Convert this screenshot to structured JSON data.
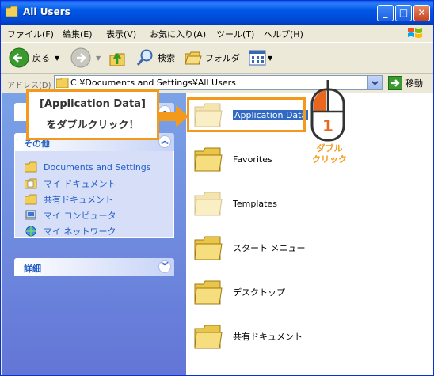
{
  "window": {
    "title": "All Users",
    "buttons": {
      "minimize": "_",
      "maximize": "□",
      "close": "✕"
    }
  },
  "menu": [
    "ファイル(F)",
    "編集(E)",
    "表示(V)",
    "お気に入り(A)",
    "ツール(T)",
    "ヘルプ(H)"
  ],
  "toolbar": {
    "back": "戻る",
    "search": "検索",
    "folders": "フォルダ"
  },
  "address": {
    "label": "アドレス(D)",
    "path": "C:¥Documents and Settings¥All Users",
    "go": "移動"
  },
  "left_pane": {
    "other_places": {
      "title": "その他",
      "links": [
        "Documents and Settings",
        "マイ ドキュメント",
        "共有ドキュメント",
        "マイ コンピュータ",
        "マイ ネットワーク"
      ]
    },
    "details": {
      "title": "詳細"
    }
  },
  "folders": [
    {
      "name": "Application Data",
      "selected": true,
      "hidden": true
    },
    {
      "name": "Favorites",
      "selected": false,
      "hidden": false
    },
    {
      "name": "Templates",
      "selected": false,
      "hidden": true
    },
    {
      "name": "スタート メニュー",
      "selected": false,
      "hidden": false
    },
    {
      "name": "デスクトップ",
      "selected": false,
      "hidden": false
    },
    {
      "name": "共有ドキュメント",
      "selected": false,
      "hidden": false
    }
  ],
  "annotation": {
    "line1": "[Application Data]",
    "line2": "をダブルクリック！",
    "step": "1",
    "caption_1": "ダブル",
    "caption_2": "クリック"
  },
  "colors": {
    "accent": "#f39a1d",
    "title_bar": "#0058e6",
    "selection": "#316ac5",
    "link": "#215dc6"
  }
}
